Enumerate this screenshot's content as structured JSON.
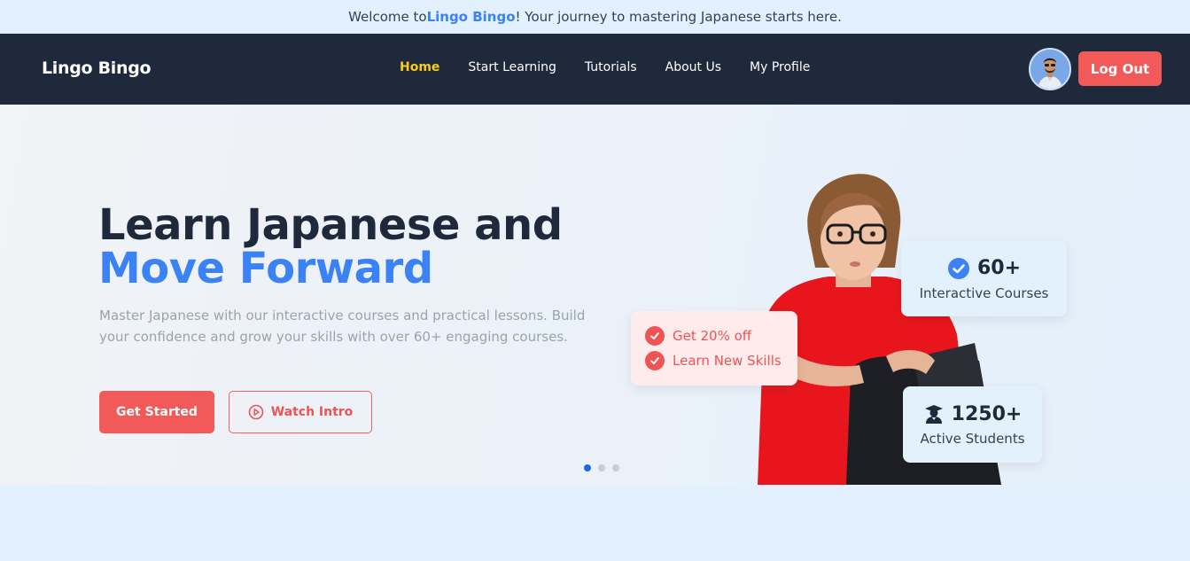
{
  "announcement": {
    "prefix": "Welcome to ",
    "brand": "Lingo Bingo",
    "suffix": "! Your journey to mastering Japanese starts here."
  },
  "navbar": {
    "logo": "Lingo Bingo",
    "links": [
      {
        "label": "Home",
        "active": true
      },
      {
        "label": "Start Learning",
        "active": false
      },
      {
        "label": "Tutorials",
        "active": false
      },
      {
        "label": "About Us",
        "active": false
      },
      {
        "label": "My Profile",
        "active": false
      }
    ],
    "logout_label": "Log Out"
  },
  "hero": {
    "title_line1": "Learn Japanese and",
    "title_line2": "Move Forward",
    "description": "Master Japanese with our interactive courses and practical lessons. Build your confidence and grow your skills with over 60+ engaging courses.",
    "primary_button": "Get Started",
    "secondary_button": "Watch Intro",
    "slides": {
      "count": 3,
      "active_index": 0
    }
  },
  "offers": [
    {
      "label": "Get 20% off"
    },
    {
      "label": "Learn New Skills"
    }
  ],
  "stats": [
    {
      "value": "60+",
      "label": "Interactive Courses",
      "icon": "check-circle-icon"
    },
    {
      "value": "1250+",
      "label": "Active Students",
      "icon": "graduate-icon"
    }
  ],
  "colors": {
    "navbar_bg": "#1e293b",
    "accent_blue": "#3b82f6",
    "accent_red": "#f25a5a",
    "active_link": "#facc15"
  }
}
